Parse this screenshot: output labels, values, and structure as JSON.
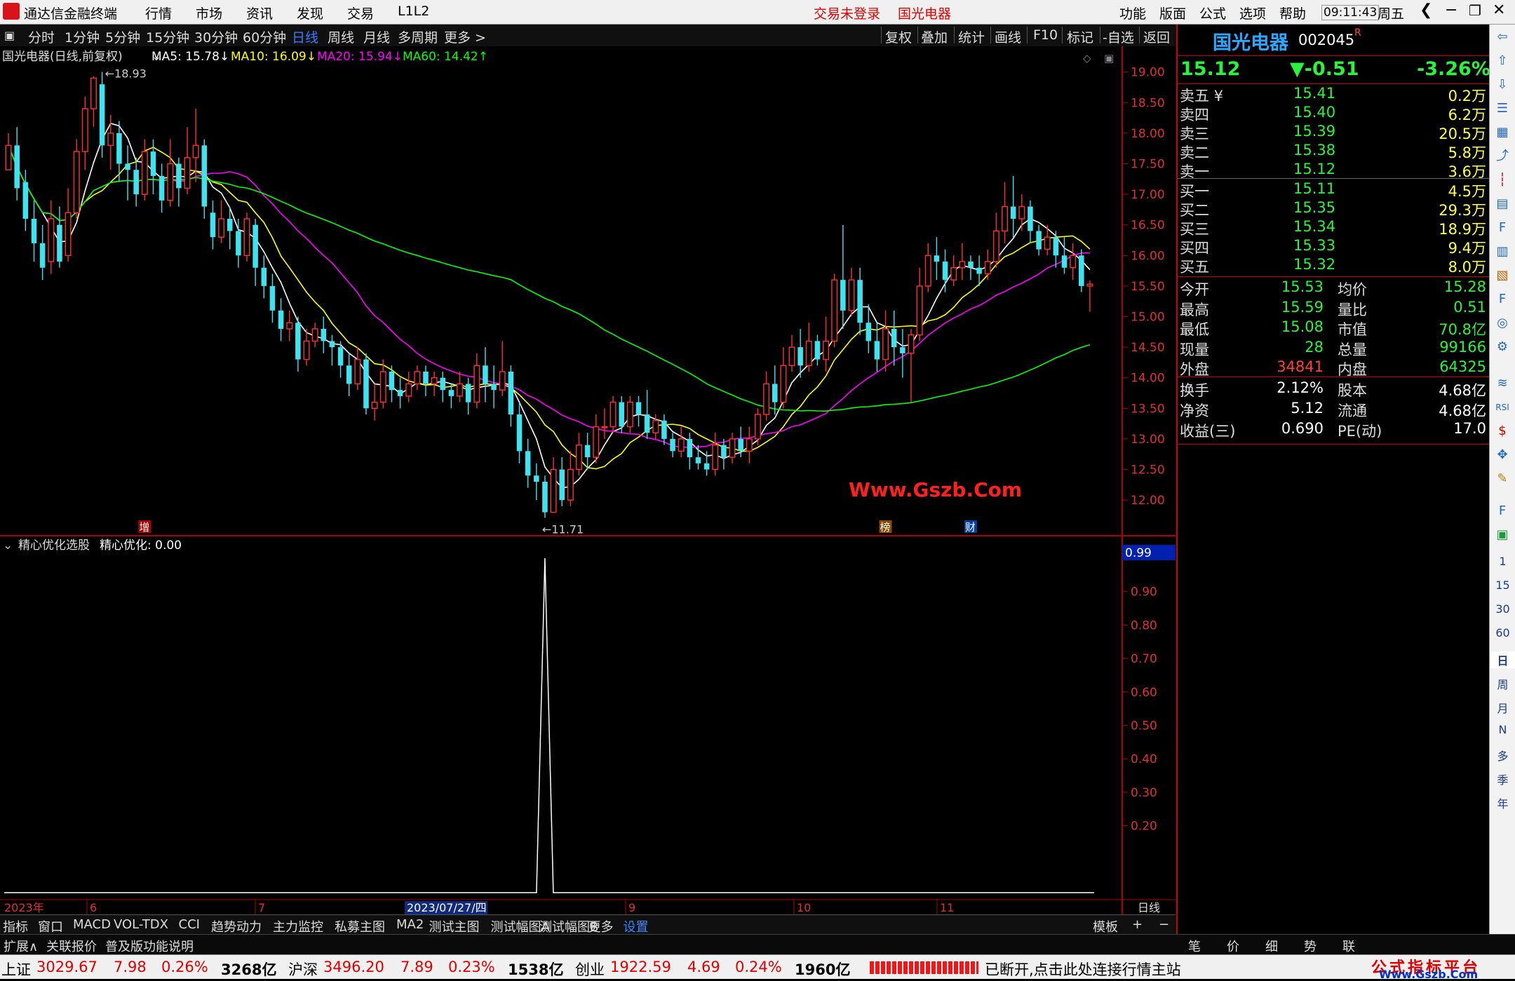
{
  "titlebar": {
    "app": "通达信金融终端",
    "menu": [
      "行情",
      "市场",
      "资讯",
      "发现",
      "交易",
      "L1L2"
    ],
    "login": "交易未登录",
    "stock": "国光电器",
    "right_menu": [
      "功能",
      "版面",
      "公式",
      "选项",
      "帮助"
    ],
    "time": "09:11:43",
    "weekday": "周五"
  },
  "periodbar": {
    "periods": [
      "分时",
      "1分钟",
      "5分钟",
      "15分钟",
      "30分钟",
      "60分钟",
      "日线",
      "周线",
      "月线",
      "多周期",
      "更多 >"
    ],
    "active": "日线",
    "tools": [
      "复权",
      "叠加",
      "统计",
      "画线",
      "F10",
      "标记",
      "-自选",
      "返回"
    ]
  },
  "chart_data": [
    {
      "type": "candlestick",
      "title": "国光电器(日线,前复权)",
      "indicators": [
        {
          "name": "MA5",
          "value": "15.78",
          "trend": "↓",
          "color": "#ffffff"
        },
        {
          "name": "MA10",
          "value": "16.09",
          "trend": "↓",
          "color": "#ffff00"
        },
        {
          "name": "MA20",
          "value": "15.94",
          "trend": "↓",
          "color": "#ff00ff"
        },
        {
          "name": "MA60",
          "value": "14.42",
          "trend": "↑",
          "color": "#00ff00"
        }
      ],
      "ylim": [
        11.6,
        19.1
      ],
      "yticks": [
        "19.00",
        "18.50",
        "18.00",
        "17.50",
        "17.00",
        "16.50",
        "16.00",
        "15.50",
        "15.00",
        "14.50",
        "14.00",
        "13.50",
        "13.00",
        "12.50",
        "12.00"
      ],
      "high_label": "18.93",
      "low_label": "11.71",
      "markers": [
        "增",
        "榜",
        "财"
      ],
      "watermark": "Www.Gszb.Com",
      "ohlc": [
        [
          17.4,
          17.8,
          17.6,
          18.0
        ],
        [
          17.8,
          17.1,
          16.9,
          18.1
        ],
        [
          17.2,
          16.6,
          16.4,
          17.4
        ],
        [
          16.6,
          16.2,
          15.9,
          16.9
        ],
        [
          16.2,
          15.8,
          15.6,
          16.5
        ],
        [
          15.9,
          16.6,
          15.7,
          16.9
        ],
        [
          16.5,
          15.9,
          15.8,
          16.8
        ],
        [
          16.0,
          16.7,
          15.9,
          17.1
        ],
        [
          16.7,
          17.7,
          16.6,
          17.9
        ],
        [
          17.7,
          18.4,
          17.4,
          18.6
        ],
        [
          18.4,
          18.9,
          18.1,
          18.93
        ],
        [
          18.8,
          17.8,
          17.6,
          19.0
        ],
        [
          17.8,
          18.0,
          17.4,
          18.3
        ],
        [
          18.0,
          17.5,
          17.2,
          18.2
        ],
        [
          17.5,
          17.4,
          16.9,
          17.8
        ],
        [
          17.4,
          17.0,
          16.8,
          17.6
        ],
        [
          17.0,
          17.7,
          16.9,
          17.9
        ],
        [
          17.7,
          17.3,
          17.0,
          17.9
        ],
        [
          17.3,
          16.9,
          16.7,
          17.5
        ],
        [
          16.9,
          17.5,
          16.8,
          17.9
        ],
        [
          17.5,
          17.1,
          16.8,
          17.6
        ],
        [
          17.1,
          17.6,
          17.0,
          18.1
        ],
        [
          17.6,
          17.8,
          17.2,
          18.4
        ],
        [
          17.8,
          16.8,
          16.6,
          17.9
        ],
        [
          16.7,
          16.3,
          16.1,
          16.9
        ],
        [
          16.3,
          16.6,
          16.2,
          16.9
        ],
        [
          16.6,
          16.4,
          16.1,
          16.8
        ],
        [
          16.4,
          16.0,
          15.8,
          16.6
        ],
        [
          16.0,
          16.6,
          15.9,
          16.7
        ],
        [
          16.5,
          15.8,
          15.5,
          16.6
        ],
        [
          15.8,
          15.5,
          15.3,
          16.0
        ],
        [
          15.5,
          15.1,
          14.9,
          15.7
        ],
        [
          15.1,
          14.8,
          14.6,
          15.3
        ],
        [
          14.8,
          14.9,
          14.6,
          15.1
        ],
        [
          14.9,
          14.3,
          14.1,
          15.0
        ],
        [
          14.3,
          14.6,
          14.2,
          14.8
        ],
        [
          14.6,
          14.8,
          14.5,
          14.9
        ],
        [
          14.8,
          14.6,
          14.4,
          15.0
        ],
        [
          14.6,
          14.5,
          14.2,
          14.7
        ],
        [
          14.5,
          14.2,
          14.0,
          14.6
        ],
        [
          14.2,
          13.9,
          13.7,
          14.4
        ],
        [
          13.9,
          14.3,
          13.8,
          14.5
        ],
        [
          14.3,
          13.5,
          13.4,
          14.4
        ],
        [
          13.5,
          13.6,
          13.3,
          13.9
        ],
        [
          13.6,
          14.1,
          13.5,
          14.3
        ],
        [
          14.1,
          13.8,
          13.6,
          14.2
        ],
        [
          13.8,
          13.7,
          13.5,
          14.0
        ],
        [
          13.7,
          13.9,
          13.6,
          14.1
        ],
        [
          13.9,
          14.1,
          13.8,
          14.2
        ],
        [
          14.1,
          13.9,
          13.7,
          14.2
        ],
        [
          13.9,
          14.0,
          13.7,
          14.1
        ],
        [
          14.0,
          13.8,
          13.6,
          14.1
        ],
        [
          13.8,
          13.7,
          13.5,
          13.9
        ],
        [
          13.7,
          13.9,
          13.6,
          14.1
        ],
        [
          13.9,
          13.6,
          13.4,
          14.0
        ],
        [
          13.6,
          14.2,
          13.5,
          14.4
        ],
        [
          14.2,
          13.9,
          13.6,
          14.5
        ],
        [
          13.9,
          13.8,
          13.5,
          14.2
        ],
        [
          13.8,
          14.1,
          13.7,
          14.6
        ],
        [
          14.1,
          13.4,
          13.2,
          14.2
        ],
        [
          13.4,
          12.8,
          12.6,
          13.6
        ],
        [
          12.8,
          12.4,
          12.2,
          13.0
        ],
        [
          12.4,
          12.3,
          12.0,
          12.6
        ],
        [
          12.3,
          11.8,
          11.71,
          12.4
        ],
        [
          11.8,
          12.5,
          11.9,
          12.7
        ],
        [
          12.5,
          12.0,
          11.9,
          12.7
        ],
        [
          12.0,
          12.5,
          11.9,
          12.8
        ],
        [
          12.5,
          12.9,
          12.4,
          13.1
        ],
        [
          12.9,
          12.7,
          12.5,
          13.1
        ],
        [
          12.7,
          13.2,
          12.6,
          13.4
        ],
        [
          13.2,
          13.2,
          13.0,
          13.5
        ],
        [
          13.2,
          13.6,
          13.1,
          13.7
        ],
        [
          13.6,
          13.2,
          13.1,
          13.7
        ],
        [
          13.2,
          13.6,
          13.1,
          13.7
        ],
        [
          13.6,
          13.4,
          13.2,
          13.7
        ],
        [
          13.4,
          13.1,
          13.0,
          13.8
        ],
        [
          13.1,
          13.3,
          13.0,
          13.4
        ],
        [
          13.3,
          13.0,
          12.9,
          13.4
        ],
        [
          13.0,
          12.8,
          12.7,
          13.1
        ],
        [
          12.8,
          13.0,
          12.7,
          13.2
        ],
        [
          13.0,
          12.7,
          12.5,
          13.1
        ],
        [
          12.7,
          12.6,
          12.5,
          12.9
        ],
        [
          12.6,
          12.5,
          12.4,
          12.8
        ],
        [
          12.5,
          12.9,
          12.4,
          13.1
        ],
        [
          12.9,
          12.7,
          12.5,
          13.0
        ],
        [
          12.7,
          13.0,
          12.6,
          13.1
        ],
        [
          13.0,
          12.8,
          12.7,
          13.2
        ],
        [
          12.8,
          13.0,
          12.6,
          13.2
        ],
        [
          13.0,
          13.4,
          12.9,
          13.5
        ],
        [
          13.4,
          13.9,
          13.3,
          14.1
        ],
        [
          13.9,
          13.6,
          13.4,
          14.2
        ],
        [
          13.6,
          14.2,
          13.5,
          14.5
        ],
        [
          14.2,
          14.5,
          14.1,
          14.7
        ],
        [
          14.5,
          14.2,
          14.0,
          14.8
        ],
        [
          14.2,
          14.6,
          14.1,
          14.9
        ],
        [
          14.6,
          14.3,
          14.2,
          14.7
        ],
        [
          14.3,
          14.6,
          14.1,
          15.0
        ],
        [
          14.6,
          15.6,
          14.5,
          15.7
        ],
        [
          15.6,
          15.1,
          14.8,
          16.5
        ],
        [
          15.1,
          15.6,
          15.0,
          15.8
        ],
        [
          15.6,
          14.9,
          14.7,
          15.8
        ],
        [
          14.9,
          14.6,
          14.4,
          15.2
        ],
        [
          14.6,
          14.3,
          14.1,
          14.9
        ],
        [
          14.3,
          14.8,
          14.1,
          15.1
        ],
        [
          14.8,
          14.5,
          14.2,
          15.1
        ],
        [
          14.5,
          14.4,
          14.0,
          14.8
        ],
        [
          14.4,
          14.7,
          13.6,
          14.8
        ],
        [
          14.7,
          15.5,
          14.6,
          15.8
        ],
        [
          15.5,
          16.0,
          15.4,
          16.2
        ],
        [
          16.0,
          15.9,
          15.6,
          16.3
        ],
        [
          15.9,
          15.6,
          15.4,
          16.1
        ],
        [
          15.6,
          15.8,
          15.5,
          16.0
        ],
        [
          15.8,
          15.9,
          15.6,
          16.2
        ],
        [
          15.9,
          15.8,
          15.6,
          16.0
        ],
        [
          15.8,
          15.7,
          15.5,
          16.0
        ],
        [
          15.7,
          15.9,
          15.6,
          16.1
        ],
        [
          15.9,
          16.4,
          15.8,
          16.7
        ],
        [
          16.4,
          16.8,
          16.2,
          17.2
        ],
        [
          16.8,
          16.6,
          16.3,
          17.3
        ],
        [
          16.6,
          16.8,
          16.4,
          17.0
        ],
        [
          16.8,
          16.4,
          16.2,
          16.9
        ],
        [
          16.4,
          16.1,
          16.0,
          16.5
        ],
        [
          16.1,
          16.3,
          16.0,
          16.5
        ],
        [
          16.3,
          16.0,
          15.8,
          16.4
        ],
        [
          16.0,
          15.8,
          15.7,
          16.3
        ],
        [
          15.8,
          16.0,
          15.6,
          16.2
        ],
        [
          16.0,
          15.5,
          15.4,
          16.1
        ],
        [
          15.5,
          15.53,
          15.08,
          15.59
        ]
      ],
      "x_labels": [
        "2023年",
        "6",
        "7",
        "2023/07/27/四",
        "9",
        "10",
        "11",
        "日线"
      ]
    },
    {
      "type": "line",
      "title": "精心优化选股",
      "series_label": "精心优化",
      "current_value": "0.00",
      "ylim": [
        0,
        1.0
      ],
      "cursor_value": "0.99",
      "yticks": [
        "0.90",
        "0.80",
        "0.70",
        "0.60",
        "0.50",
        "0.40",
        "0.30",
        "0.20"
      ],
      "spike_index": 63,
      "spike_value": 1.0
    }
  ],
  "quote": {
    "name": "国光电器",
    "code": "002045",
    "r_mark": "R",
    "price": "15.12",
    "change": "▼-0.51",
    "pct": "-3.26%",
    "sell": [
      {
        "label": "卖五 ¥",
        "price": "15.41",
        "vol": "0.2万"
      },
      {
        "label": "卖四",
        "price": "15.40",
        "vol": "6.2万"
      },
      {
        "label": "卖三",
        "price": "15.39",
        "vol": "20.5万"
      },
      {
        "label": "卖二",
        "price": "15.38",
        "vol": "5.8万"
      },
      {
        "label": "卖一",
        "price": "15.12",
        "vol": "3.6万"
      }
    ],
    "buy": [
      {
        "label": "买一",
        "price": "15.11",
        "vol": "4.5万"
      },
      {
        "label": "买二",
        "price": "15.35",
        "vol": "29.3万"
      },
      {
        "label": "买三",
        "price": "15.34",
        "vol": "18.9万"
      },
      {
        "label": "买四",
        "price": "15.33",
        "vol": "9.4万"
      },
      {
        "label": "买五",
        "price": "15.32",
        "vol": "8.0万"
      }
    ],
    "stats1": [
      {
        "l": "今开",
        "v": "15.53",
        "l2": "均价",
        "v2": "15.28"
      },
      {
        "l": "最高",
        "v": "15.59",
        "l2": "量比",
        "v2": "0.51"
      },
      {
        "l": "最低",
        "v": "15.08",
        "l2": "市值",
        "v2": "70.8亿"
      },
      {
        "l": "现量",
        "v": "28",
        "l2": "总量",
        "v2": "99166"
      },
      {
        "l": "外盘",
        "v": "34841",
        "l2": "内盘",
        "v2": "64325"
      }
    ],
    "stats2": [
      {
        "l": "换手",
        "v": "2.12%",
        "l2": "股本",
        "v2": "4.68亿"
      },
      {
        "l": "净资",
        "v": "5.12",
        "l2": "流通",
        "v2": "4.68亿"
      },
      {
        "l": "收益(三)",
        "v": "0.690",
        "l2": "PE(动)",
        "v2": "17.0"
      }
    ],
    "bottom_tabs": [
      "笔",
      "价",
      "细",
      "势",
      "联"
    ]
  },
  "sidebar": {
    "nums": [
      "1",
      "15",
      "30",
      "60",
      "日",
      "周",
      "月",
      "N",
      "多",
      "季",
      "年"
    ]
  },
  "tabbar": {
    "tabs": [
      "指标",
      "窗口",
      "MACD",
      "VOL-TDX",
      "CCI",
      "趋势动力",
      "主力监控",
      "私募主图",
      "MA2",
      "测试主图",
      "测试幅图A",
      "测试幅图B",
      "更多",
      "设置"
    ],
    "right": [
      "模板",
      "+",
      "−"
    ]
  },
  "extbar": [
    "扩展∧",
    "关联报价",
    "普及版功能说明"
  ],
  "statusbar": {
    "items": [
      {
        "name": "上证",
        "val": "3029.67",
        "chg": "7.98",
        "pct": "0.26%",
        "amt": "3268亿"
      },
      {
        "name": "沪深",
        "val": "3496.20",
        "chg": "7.89",
        "pct": "0.23%",
        "amt": "1538亿"
      },
      {
        "name": "创业",
        "val": "1922.59",
        "chg": "4.69",
        "pct": "0.24%",
        "amt": "1960亿"
      }
    ],
    "conn": "已断开,点击此处连接行情主站",
    "brand": "公式指标平台",
    "brand_url": "Www.Gszb.Com"
  }
}
